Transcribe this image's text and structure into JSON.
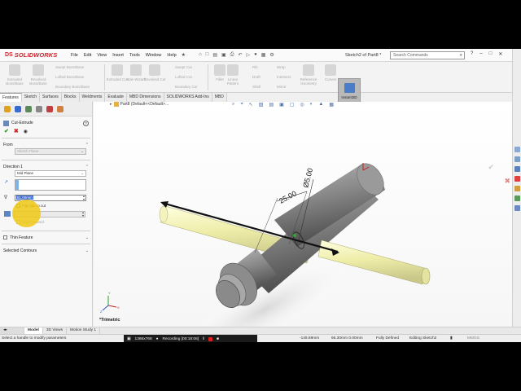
{
  "titlebar": {
    "logo": "SOLIDWORKS",
    "logo_mark": "DS",
    "menu": [
      "File",
      "Edit",
      "View",
      "Insert",
      "Tools",
      "Window",
      "Help"
    ],
    "document_title": "Sketch2 of Part8 *",
    "search_placeholder": "Search Commands"
  },
  "command_manager": {
    "big_buttons": [
      "Extruded Boss/Base",
      "Revolved Boss/Base",
      "Extruded Cut",
      "Hole Wizard",
      "Revolved Cut",
      "Fillet",
      "Linear Pattern",
      "Rib",
      "Wrap",
      "Reference Geometry",
      "Curves",
      "Instant3D"
    ],
    "small_buttons": [
      "Swept Boss/Base",
      "Lofted Boss/Base",
      "Boundary Boss/Base",
      "Swept Cut",
      "Lofted Cut",
      "Boundary Cut",
      "Draft",
      "Intersect",
      "Shell",
      "Mirror"
    ]
  },
  "tabs": [
    "Features",
    "Sketch",
    "Surfaces",
    "Blocks",
    "Weldments",
    "Evaluate",
    "MBD Dimensions",
    "SOLIDWORKS Add-Ins",
    "MBD"
  ],
  "active_tab": "Features",
  "property_manager": {
    "title": "Cut-Extrude",
    "from_label": "From",
    "from_value": "Sketch Plane",
    "direction_label": "Direction 1",
    "end_condition": "Mid Plane",
    "depth": "81.00mm",
    "flip_side": "Flip side to cut",
    "draft": "Draft outward",
    "thin_feature": "Thin Feature",
    "selected_contours": "Selected Contours"
  },
  "graphics": {
    "tree_crumb": "Part8 (Default<<Default>...",
    "view_label": "*Trimetric",
    "dim_1": "25.00",
    "dim_2": "Ø5.00",
    "axis_labels": [
      "X",
      "Y",
      "Z"
    ],
    "colors": {
      "shaft": "#8a8a8a",
      "cylinder": "#f0efb4",
      "sketch_line": "#1a1a1a"
    }
  },
  "bottom_tabs": [
    "Model",
    "3D Views",
    "Motion Study 1"
  ],
  "status": {
    "hint": "Select a handle to modify parameters",
    "resolution": "1366x768",
    "recording": "Recording [00:18:06]",
    "coords": "-149.89mm",
    "coords2": "66.30mm 0.00mm",
    "state": "Fully Defined",
    "mode": "Editing Sketch2",
    "units": "MMGS"
  }
}
